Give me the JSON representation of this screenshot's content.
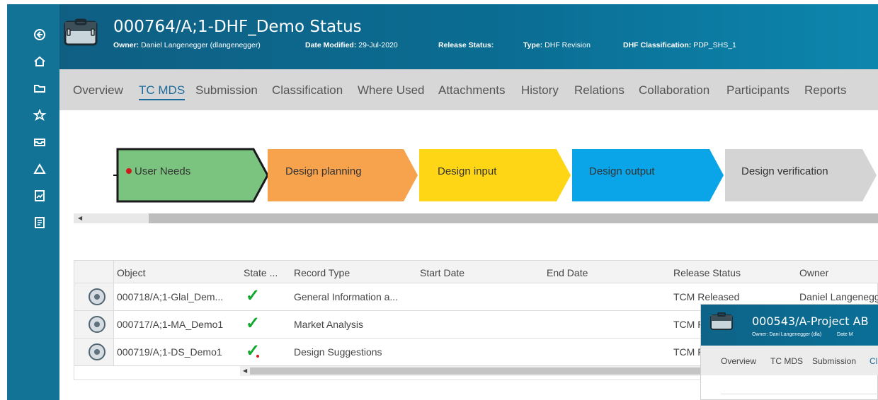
{
  "icons": {
    "left": [
      "back-icon",
      "home-icon",
      "folder-icon",
      "star-icon",
      "inbox-icon",
      "warning-icon",
      "report-icon",
      "document-icon"
    ]
  },
  "header": {
    "title": "000764/A;1-DHF_Demo Status",
    "owner_label": "Owner:",
    "owner_value": "Daniel Langenegger (dlangenegger)",
    "date_label": "Date Modified:",
    "date_value": "29-Jul-2020",
    "release_label": "Release Status:",
    "release_value": "",
    "type_label": "Type:",
    "type_value": "DHF Revision",
    "classification_label": "DHF Classification:",
    "classification_value": "PDP_SHS_1"
  },
  "tabs": [
    "Overview",
    "TC MDS",
    "Submission",
    "Classification",
    "Where Used",
    "Attachments",
    "History",
    "Relations",
    "Collaboration",
    "Participants",
    "Reports"
  ],
  "flow": {
    "steps": [
      {
        "label": "User Needs",
        "color": "#7bc47f"
      },
      {
        "label": "Design planning",
        "color": "#f7a24d"
      },
      {
        "label": "Design input",
        "color": "#ffd616"
      },
      {
        "label": "Design output",
        "color": "#0aa4e8"
      },
      {
        "label": "Design verification",
        "color": "#d4d4d4"
      }
    ]
  },
  "table": {
    "headers": [
      "Object",
      "State ...",
      "Record Type",
      "Start Date",
      "End Date",
      "Release Status",
      "Owner"
    ],
    "rows": [
      {
        "object": "000718/A;1-Glal_Dem...",
        "record_type": "General Information a...",
        "start_date": "",
        "end_date": "",
        "release_status": "TCM Released",
        "owner": "Daniel Langenegg"
      },
      {
        "object": "000717/A;1-MA_Demo1",
        "record_type": "Market Analysis",
        "start_date": "",
        "end_date": "",
        "release_status": "TCM R",
        "owner": ""
      },
      {
        "object": "000719/A;1-DS_Demo1",
        "record_type": "Design Suggestions",
        "start_date": "",
        "end_date": "",
        "release_status": "TCM R",
        "owner": ""
      }
    ]
  },
  "overlay": {
    "title": "000543/A-Project AB",
    "owner_text": "Owner: Dani Langenegger (dla)",
    "date_text": "Date M",
    "tabs": [
      "Overview",
      "TC MDS",
      "Submission",
      "Cl"
    ]
  },
  "colors": {
    "sidebar": "#127396",
    "header": "#0b6d93",
    "accent": "#1b6c9d",
    "check": "#11a72d"
  }
}
